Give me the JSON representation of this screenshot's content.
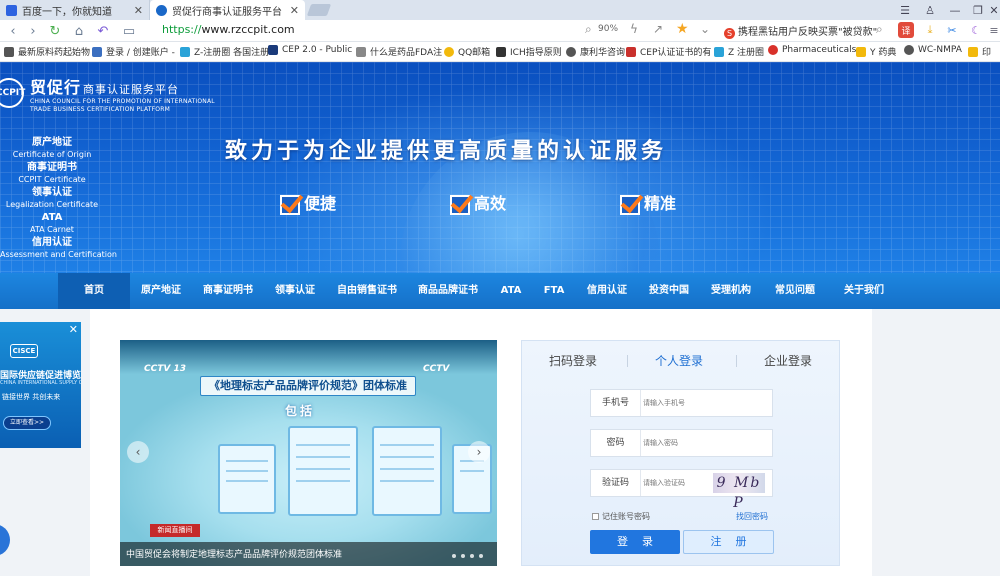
{
  "browser": {
    "tabs": [
      {
        "label": "百度一下，你就知道",
        "active": false
      },
      {
        "label": "贸促行商事认证服务平台",
        "active": true
      }
    ],
    "url": {
      "protocol": "https://",
      "host": "www.rzccpit.com"
    },
    "zoom": "90%",
    "news_ticker": "携程黑钻用户反映买票\"被贷款\"",
    "translate_label": "译",
    "bookmarks": [
      "最新原料药起始物",
      "登录 / 创建账户 -",
      "Z-注册圈 各国注册",
      "CEP 2.0 - Public",
      "什么是药品FDA注",
      "QQ邮箱",
      "ICH指导原则",
      "康利华咨询",
      "CEP认证证书的有",
      "Z 注册圈",
      "Pharmaceuticals",
      "Y 药典",
      "WC-NMPA",
      "印"
    ]
  },
  "site": {
    "logo": {
      "mark": "CCPIT",
      "name_cn": "贸促行",
      "name_cn_sub": "商事认证服务平台",
      "name_en_line1": "CHINA COUNCIL FOR THE PROMOTION OF INTERNATIONAL",
      "name_en_line2": "TRADE BUSINESS CERTIFICATION PLATFORM"
    },
    "side_menu": [
      {
        "cn": "原产地证",
        "en": "Certificate of Origin"
      },
      {
        "cn": "商事证明书",
        "en": "CCPIT Certificate"
      },
      {
        "cn": "领事认证",
        "en": "Legalization Certificate"
      },
      {
        "cn": "ATA",
        "en": "ATA Carnet"
      },
      {
        "cn": "信用认证",
        "en": "Assessment and Certification"
      }
    ],
    "slogan": "致力于为企业提供更高质量的认证服务",
    "features": [
      "便捷",
      "高效",
      "精准"
    ],
    "nav": [
      "首页",
      "原产地证",
      "商事证明书",
      "领事认证",
      "自由销售证书",
      "商品品牌证书",
      "ATA",
      "FTA",
      "信用认证",
      "投资中国",
      "受理机构",
      "常见问题",
      "关于我们"
    ],
    "nav_active": 0
  },
  "ad": {
    "logo": "CISCE",
    "title": "国际供应链促进博览会",
    "subtitle": "CHINA INTERNATIONAL SUPPLY CHAIN EXPO",
    "slogan": "链接世界 共创未来",
    "button": "立即查看>>"
  },
  "video": {
    "channel_left": "CCTV 13",
    "channel_right": "CCTV",
    "title": "《地理标志产品品牌评价规范》团体标准",
    "subhead": "包括",
    "badge": "新闻直播间",
    "caption": "中国贸促会将制定地理标志产品品牌评价规范团体标准"
  },
  "login": {
    "tabs": [
      "扫码登录",
      "个人登录",
      "企业登录"
    ],
    "active_tab": 1,
    "phone_label": "手机号",
    "phone_placeholder": "请输入手机号",
    "password_label": "密码",
    "password_placeholder": "请输入密码",
    "captcha_label": "验证码",
    "captcha_placeholder": "请输入验证码",
    "captcha_text": "9 Mb P",
    "remember_label": "记住账号密码",
    "forgot_label": "找回密码",
    "login_button": "登录",
    "register_button": "注册"
  },
  "colors": {
    "brand_blue": "#1570c8",
    "accent_orange": "#ff7a1a",
    "link_blue": "#1f6fd2"
  }
}
